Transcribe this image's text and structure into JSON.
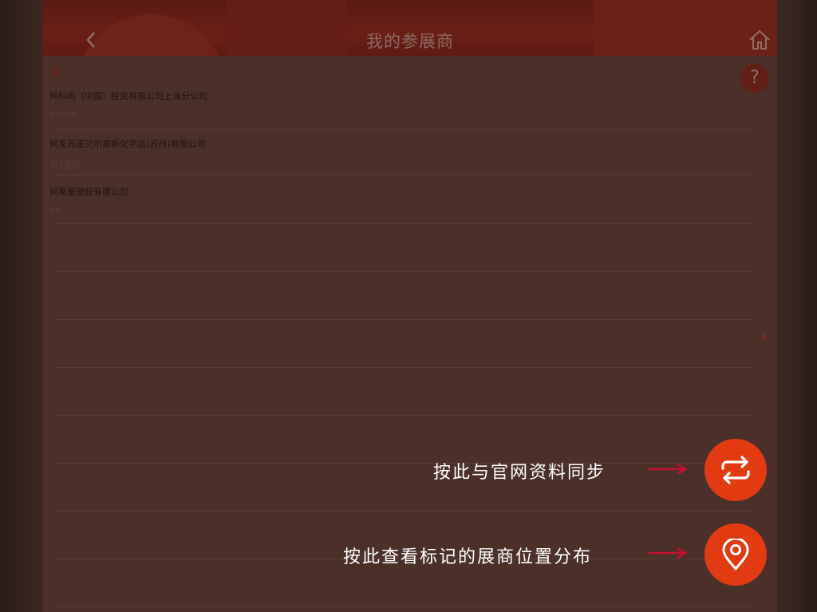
{
  "header": {
    "title": "我的参展商"
  },
  "list": {
    "section_letter": "A",
    "index_letter": "A",
    "items": [
      {
        "name": "阿科玛（中国）投资有限公司上海分公司",
        "sub": ""
      },
      {
        "name": "阿克苏诺贝尔高新化学品(苏州)有限公司",
        "sub": "Ablaze"
      },
      {
        "name": "阿莱豪塑胶有限公司",
        "sub": "宁上阿彩"
      }
    ],
    "footer_sub": "AB"
  },
  "hints": {
    "sync_text": "按此与官网资料同步",
    "map_text": "按此查看标记的展商位置分布"
  },
  "colors": {
    "accent": "#e23b12",
    "arrow": "#c8102e"
  },
  "icons": {
    "sync": "sync-icon",
    "map": "location-pin-icon"
  }
}
